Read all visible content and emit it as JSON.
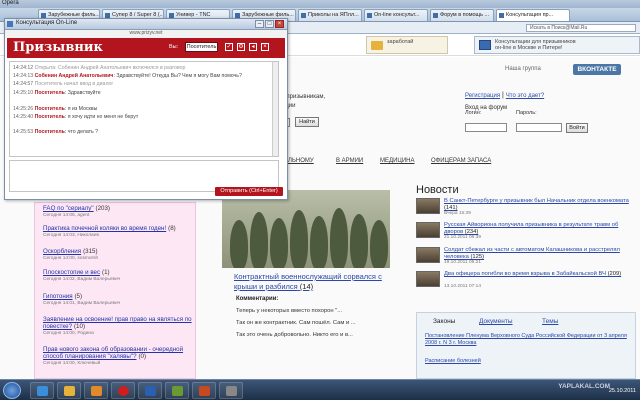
{
  "browser": {
    "app_name": "Opera",
    "tabs": [
      {
        "label": "Зарубежные филь...",
        "active": false
      },
      {
        "label": "Супер 8 / Super 8 (...",
        "active": false
      },
      {
        "label": "Универ - TNC",
        "active": false
      },
      {
        "label": "Зарубежные филь...",
        "active": false
      },
      {
        "label": "Приколы на ЯПлл...",
        "active": false
      },
      {
        "label": "On-line консульт...",
        "active": false
      },
      {
        "label": "Форум в помощь ...",
        "active": false
      },
      {
        "label": "Консультация пр...",
        "active": true
      }
    ],
    "search_placeholder": "Искать в Поиск@Mail.Ru"
  },
  "header": {
    "banner_left": "заработай",
    "banner_right": "Консультации для призывников\nон-line в Москве и Питере!"
  },
  "group_bar": {
    "label": "Наша группа",
    "vk_label": "ВКОНТАКТЕ"
  },
  "login": {
    "register": "Регистрация",
    "separator": " | ",
    "what_is": "Что это дает?",
    "title": "Вход на форум",
    "login_label": "Логин:",
    "password_label": "Пароль:",
    "button": "Войти"
  },
  "partial": {
    "line1": "т призывникам,",
    "line2": "ации",
    "button": "Найти"
  },
  "nav": {
    "items": [
      "ЛЬНОМУ",
      "В АРМИИ",
      "МЕДИЦИНА",
      "ОФИЦЕРАМ ЗАПАСА"
    ]
  },
  "left_topics": [
    {
      "title": "FAQ по \"сериалу\"",
      "count": "(203)",
      "meta": "Сегодня 14:05, agent"
    },
    {
      "title": "Практика почечной коляки во время годен!",
      "count": "(8)",
      "meta": "Сегодня 14:03, Николаев"
    },
    {
      "title": "Оскорбления",
      "count": "(315)",
      "meta": "Сегодня 14:00, sosmorsh"
    },
    {
      "title": "Плоскостопие и вес",
      "count": "(1)",
      "meta": "Сегодня 14:02, Вадим Валерьевич"
    },
    {
      "title": "Гипотония",
      "count": "(5)",
      "meta": "Сегодня 14:01, Вадим Валерьевич"
    },
    {
      "title": "Заявление на освоение! прав право на являться по повестке?",
      "count": "(10)",
      "meta": "Сегодня 14:00, Родина"
    },
    {
      "title": "Прав нового закона об образовании - очередной способ планирования \"халявы\"?",
      "count": "(0)",
      "meta": "Сегодня 14:00, Ключевый"
    }
  ],
  "article": {
    "title": "Контрактный военнослужащий сорвался с крыши и разбился",
    "count": "(14)",
    "comments_label": "Комментарии:",
    "comments": [
      "Теперь у некоторых вместо похорон \"...",
      "Так он же контрактник. Сам пошёл. Сам и ...",
      "Так это очень добровольно. Никто его и в..."
    ]
  },
  "news": {
    "heading": "Новости",
    "items": [
      {
        "title": "В Санкт-Петербурге у призывник был Начальник отдела военкомата",
        "count": "(141)",
        "date": "Вчера 15:39"
      },
      {
        "title": "Русская Айвориона получила призывника в результате травм об дворов",
        "count": "(234)",
        "date": "21.10.2011 06:39"
      },
      {
        "title": "Солдат сбежал из части с автоматом Калашникова и расстрелял человека",
        "count": "(125)",
        "date": "19.10.2011 05:21"
      },
      {
        "title": "Два офицера погибли во время взрыва в Забайкальской ВЧ",
        "count": "(209)",
        "date": "13.10.2011 07:14"
      }
    ]
  },
  "bottom_tabs": {
    "tabs": [
      "Законы",
      "Документы",
      "Темы"
    ],
    "content_link": "Постановление Пленума Верховного Суда Российской Федерации от 3 апреля 2008 г. N 3 г. Москва",
    "content_link2": "Расписание болезней"
  },
  "chat": {
    "window_title": "Консультация On-Line",
    "url": "www.prizyv.net",
    "logo": "Призывник",
    "you_label": "Вы:",
    "you_name": "Посетитель",
    "messages": [
      {
        "time": "14:24:12",
        "who": "",
        "text": "Открыта: Собенин Андрей Анатольевич включился в разговор",
        "system": true
      },
      {
        "time": "14:24:13",
        "who": "Собенин Андрей Анатольевич",
        "text": "Здравствуйте! Откуда Вы? Чем я могу Вам помочь?",
        "system": false
      },
      {
        "time": "14:24:57",
        "who": "",
        "text": "Посетитель начал ввод в диалог",
        "system": true
      },
      {
        "time": "14:25:10",
        "who": "Посетитель",
        "text": "Здравствуйте",
        "system": false
      },
      {
        "time": "14:25:26",
        "who": "Посетитель",
        "text": "я из Москвы",
        "system": false
      },
      {
        "time": "14:25:40",
        "who": "Посетитель",
        "text": "я хочу идти но меня не берут",
        "system": false
      },
      {
        "time": "14:25:53",
        "who": "Посетитель",
        "text": "что делать ?",
        "system": false
      }
    ],
    "send_label": "Отправить (Ctrl+Enter)"
  },
  "taskbar": {
    "watermark": "YAPLAKAL.COM",
    "clock": "25.10.2011"
  }
}
